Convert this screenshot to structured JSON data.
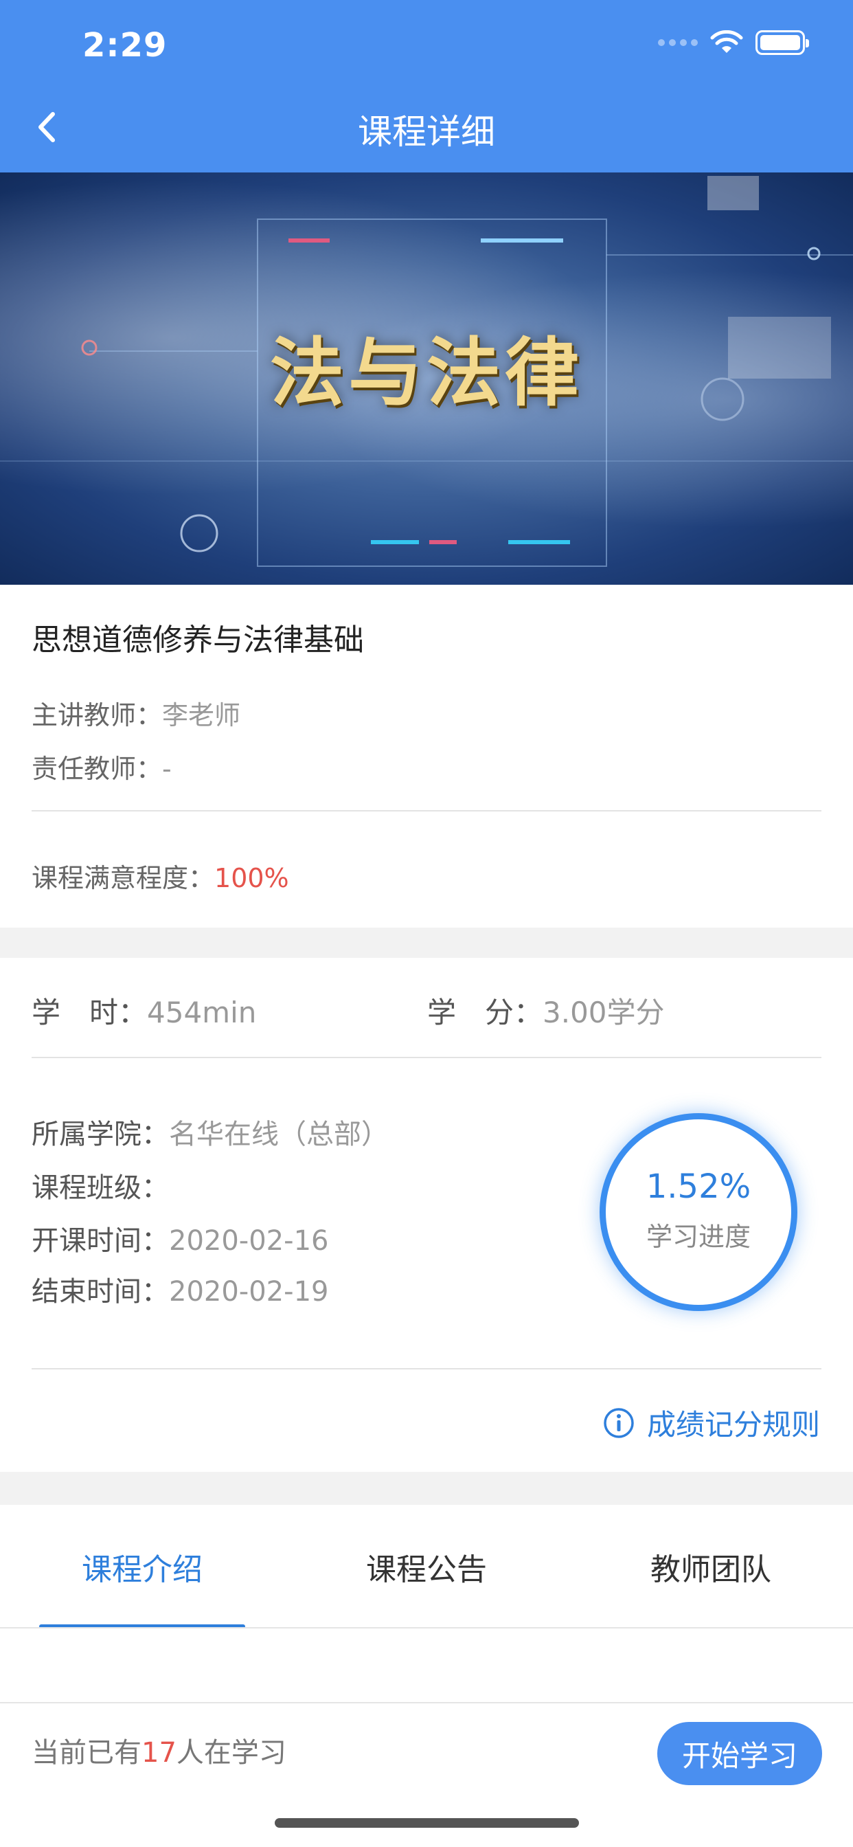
{
  "status_bar": {
    "time": "2:29"
  },
  "nav": {
    "title": "课程详细"
  },
  "banner": {
    "title_text": "法与法律"
  },
  "course": {
    "name": "思想道德修养与法律基础",
    "lead_teacher_label": "主讲教师：",
    "lead_teacher_value": "李老师",
    "responsible_teacher_label": "责任教师：",
    "responsible_teacher_value": "-",
    "satisfaction_label": "课程满意程度：",
    "satisfaction_value": "100%"
  },
  "stats": {
    "hours_label": "学　时：",
    "hours_value": "454min",
    "credits_label": "学　分：",
    "credits_value": "3.00学分"
  },
  "details": {
    "college_label": "所属学院：",
    "college_value": "名华在线（总部）",
    "class_label": "课程班级：",
    "class_value": "",
    "start_label": "开课时间：",
    "start_value": "2020-02-16",
    "end_label": "结束时间：",
    "end_value": "2020-02-19"
  },
  "progress": {
    "value": "1.52%",
    "label": "学习进度",
    "fraction": 0.0152
  },
  "grading_rule_link": "成绩记分规则",
  "tabs": [
    {
      "label": "课程介绍",
      "active": true
    },
    {
      "label": "课程公告",
      "active": false
    },
    {
      "label": "教师团队",
      "active": false
    }
  ],
  "footer": {
    "learners_prefix": "当前已有",
    "learners_count": "17",
    "learners_suffix": "人在学习",
    "start_button": "开始学习"
  },
  "colors": {
    "primary": "#4a8ff0",
    "accent_red": "#e5534b",
    "link_blue": "#2e7fdc"
  }
}
